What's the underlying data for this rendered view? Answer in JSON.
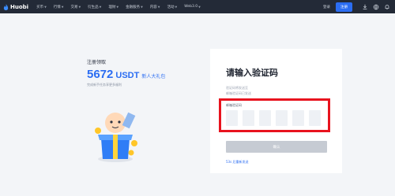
{
  "header": {
    "brand": "Huobi",
    "nav": [
      {
        "label": "买币",
        "dropdown": true
      },
      {
        "label": "行情",
        "dropdown": true
      },
      {
        "label": "交易",
        "dropdown": true
      },
      {
        "label": "衍生品",
        "dropdown": true
      },
      {
        "label": "理财",
        "dropdown": true
      },
      {
        "label": "金融服务",
        "dropdown": true
      },
      {
        "label": "内容",
        "dropdown": true
      },
      {
        "label": "活动",
        "dropdown": true
      },
      {
        "label": "Web3.0",
        "dropdown": true
      }
    ],
    "login": "登录",
    "register": "注册",
    "icons": [
      "download-icon",
      "globe-icon",
      "notification-icon"
    ]
  },
  "promo": {
    "title": "注册领取",
    "amount": "5672",
    "unit": "USDT",
    "gift": "新人大礼包",
    "subtitle": "完成新手任务享更多福利"
  },
  "verify": {
    "title": "请输入验证码",
    "line1": "验证码将发送至",
    "line2": "邮箱验证码已发送",
    "code_label": "邮箱验证码",
    "code_boxes": [
      "",
      "",
      "",
      "",
      "",
      ""
    ],
    "confirm": "确认",
    "resend": "53s 后重新发送"
  },
  "colors": {
    "accent": "#2b6df2",
    "header_bg": "#232a37",
    "highlight": "#e8131e"
  }
}
